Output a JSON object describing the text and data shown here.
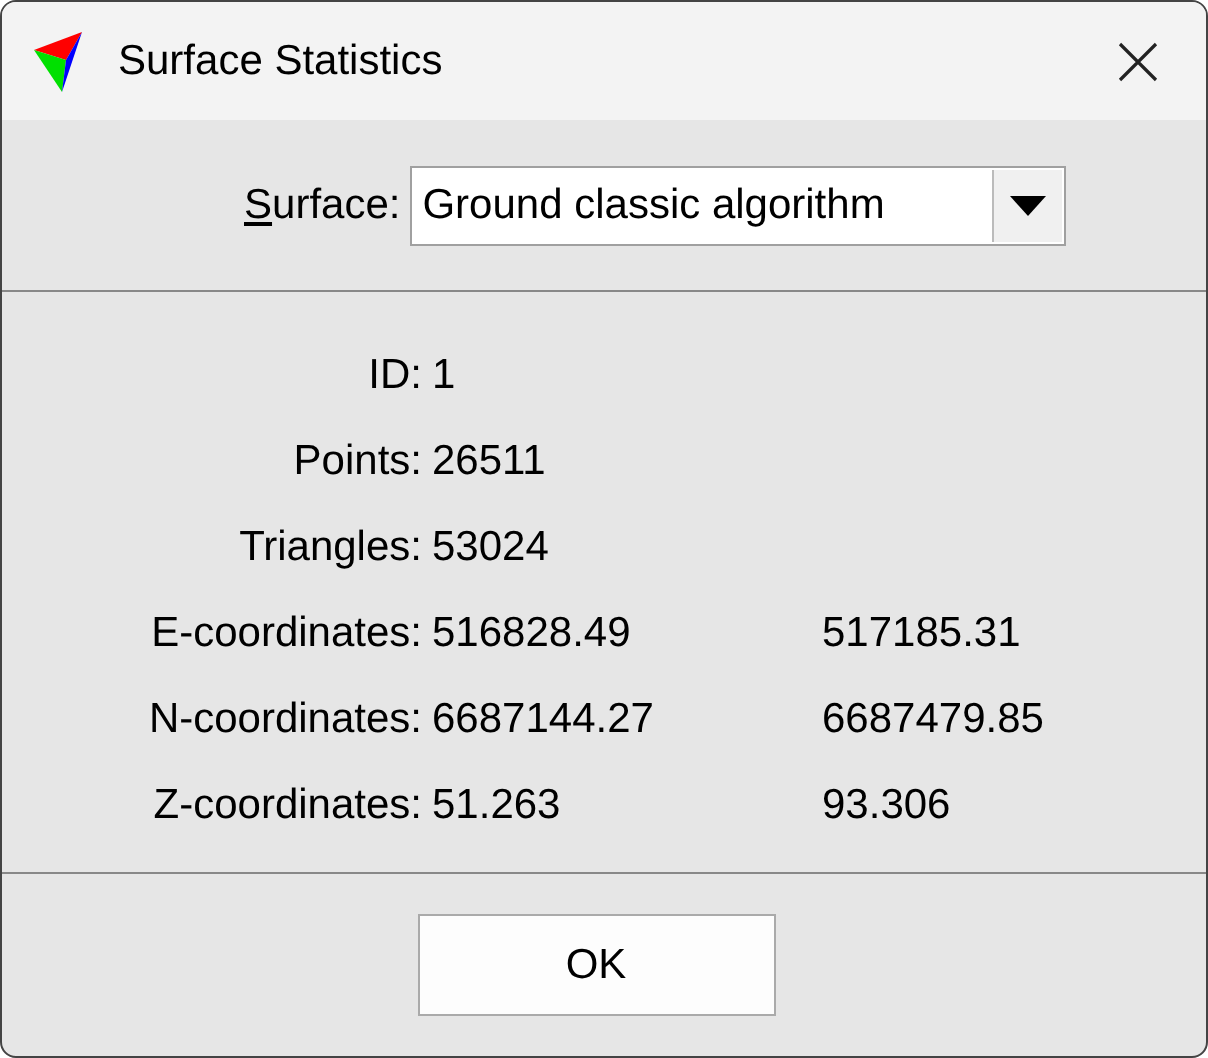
{
  "window": {
    "title": "Surface Statistics"
  },
  "surface": {
    "label": {
      "access_key": "S",
      "rest": "urface:"
    },
    "value": "Ground classic algorithm"
  },
  "stats": [
    {
      "label": "ID:",
      "values": [
        "1"
      ]
    },
    {
      "label": "Points:",
      "values": [
        "26511"
      ]
    },
    {
      "label": "Triangles:",
      "values": [
        "53024"
      ]
    },
    {
      "label": "E-coordinates:",
      "values": [
        "516828.49",
        "517185.31"
      ]
    },
    {
      "label": "N-coordinates:",
      "values": [
        "6687144.27",
        "6687479.85"
      ]
    },
    {
      "label": "Z-coordinates:",
      "values": [
        "51.263",
        "93.306"
      ]
    }
  ],
  "buttons": [
    "OK"
  ]
}
